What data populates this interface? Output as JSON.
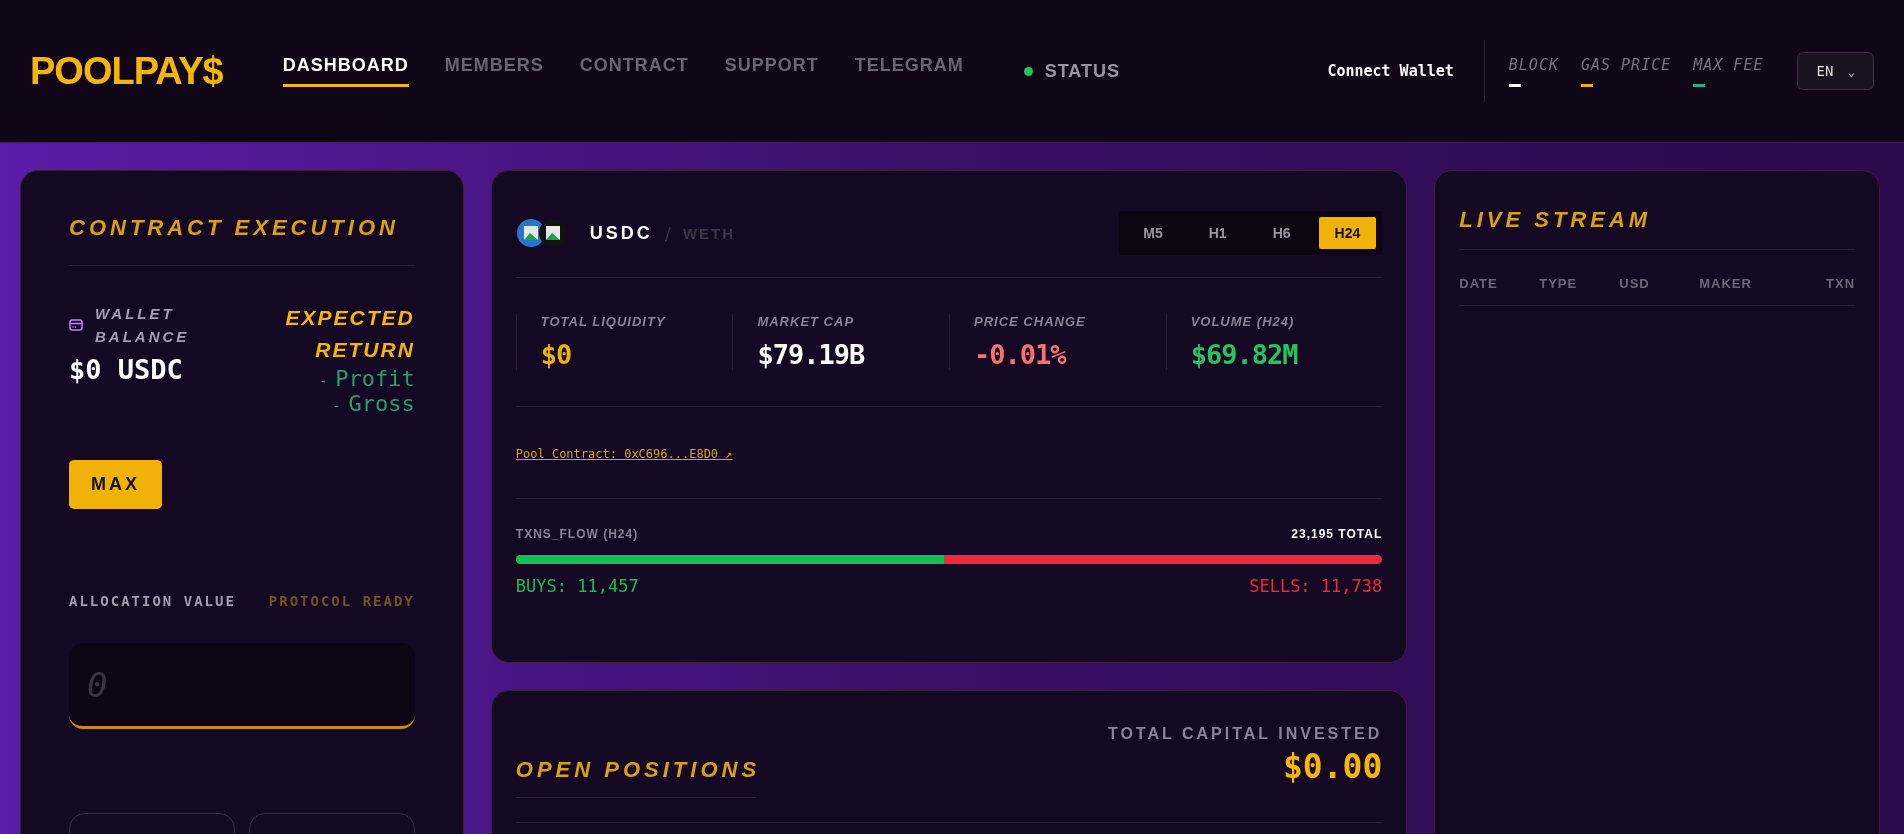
{
  "header": {
    "logo": "POOLPAY$",
    "nav": [
      {
        "label": "DASHBOARD",
        "selected": true
      },
      {
        "label": "MEMBERS",
        "selected": false
      },
      {
        "label": "CONTRACT",
        "selected": false
      },
      {
        "label": "SUPPORT",
        "selected": false
      },
      {
        "label": "TELEGRAM",
        "selected": false
      }
    ],
    "status": {
      "label": "STATUS",
      "color": "#22c55e"
    },
    "connect": "Connect Wallet",
    "stats": [
      {
        "label": "BLOCK",
        "color": "#ffffff"
      },
      {
        "label": "GAS PRICE",
        "color": "#eab308"
      },
      {
        "label": "MAX FEE",
        "color": "#10b981"
      }
    ],
    "language": "EN",
    "language_caret": "⌄"
  },
  "execution": {
    "title": "CONTRACT EXECUTION",
    "wallet_label": "WALLET BALANCE",
    "wallet_value": "$0 USDC",
    "return_label": "EXPECTED RETURN",
    "return_lines": [
      {
        "dash": "-",
        "text": "Profit"
      },
      {
        "dash": "-",
        "text": "Gross"
      }
    ],
    "max_button": "MAX",
    "allocation_label": "ALLOCATION VALUE",
    "protocol_label": "PROTOCOL READY",
    "amount": {
      "placeholder": "0"
    }
  },
  "pool": {
    "base": "USDC",
    "separator": "/",
    "quote": "WETH",
    "timeframes": [
      {
        "label": "M5",
        "selected": false
      },
      {
        "label": "H1",
        "selected": false
      },
      {
        "label": "H6",
        "selected": false
      },
      {
        "label": "H24",
        "selected": true
      }
    ],
    "metrics": [
      {
        "label": "TOTAL LIQUIDITY",
        "value": "$0",
        "color": "#eab308"
      },
      {
        "label": "MARKET CAP",
        "value": "$79.19B",
        "color": "#ffffff"
      },
      {
        "label": "PRICE CHANGE",
        "value": "-0.01%",
        "color": "#f87171"
      },
      {
        "label": "VOLUME (H24)",
        "value": "$69.82M",
        "color": "#22c55e"
      }
    ],
    "contract_link": "Pool Contract: 0xC696...E8D0 ↗",
    "flow": {
      "label": "TXNS_FLOW (H24)",
      "total": "23,195 TOTAL",
      "level": 0.494,
      "buys": "BUYS: 11,457",
      "sells": "SELLS: 11,738"
    }
  },
  "positions": {
    "title": "OPEN POSITIONS",
    "invested_label": "TOTAL CAPITAL INVESTED",
    "invested_value": "$0.00"
  },
  "live_stream": {
    "title": "LIVE STREAM",
    "columns": [
      "DATE",
      "TYPE",
      "USD",
      "MAKER",
      "TXN"
    ]
  }
}
